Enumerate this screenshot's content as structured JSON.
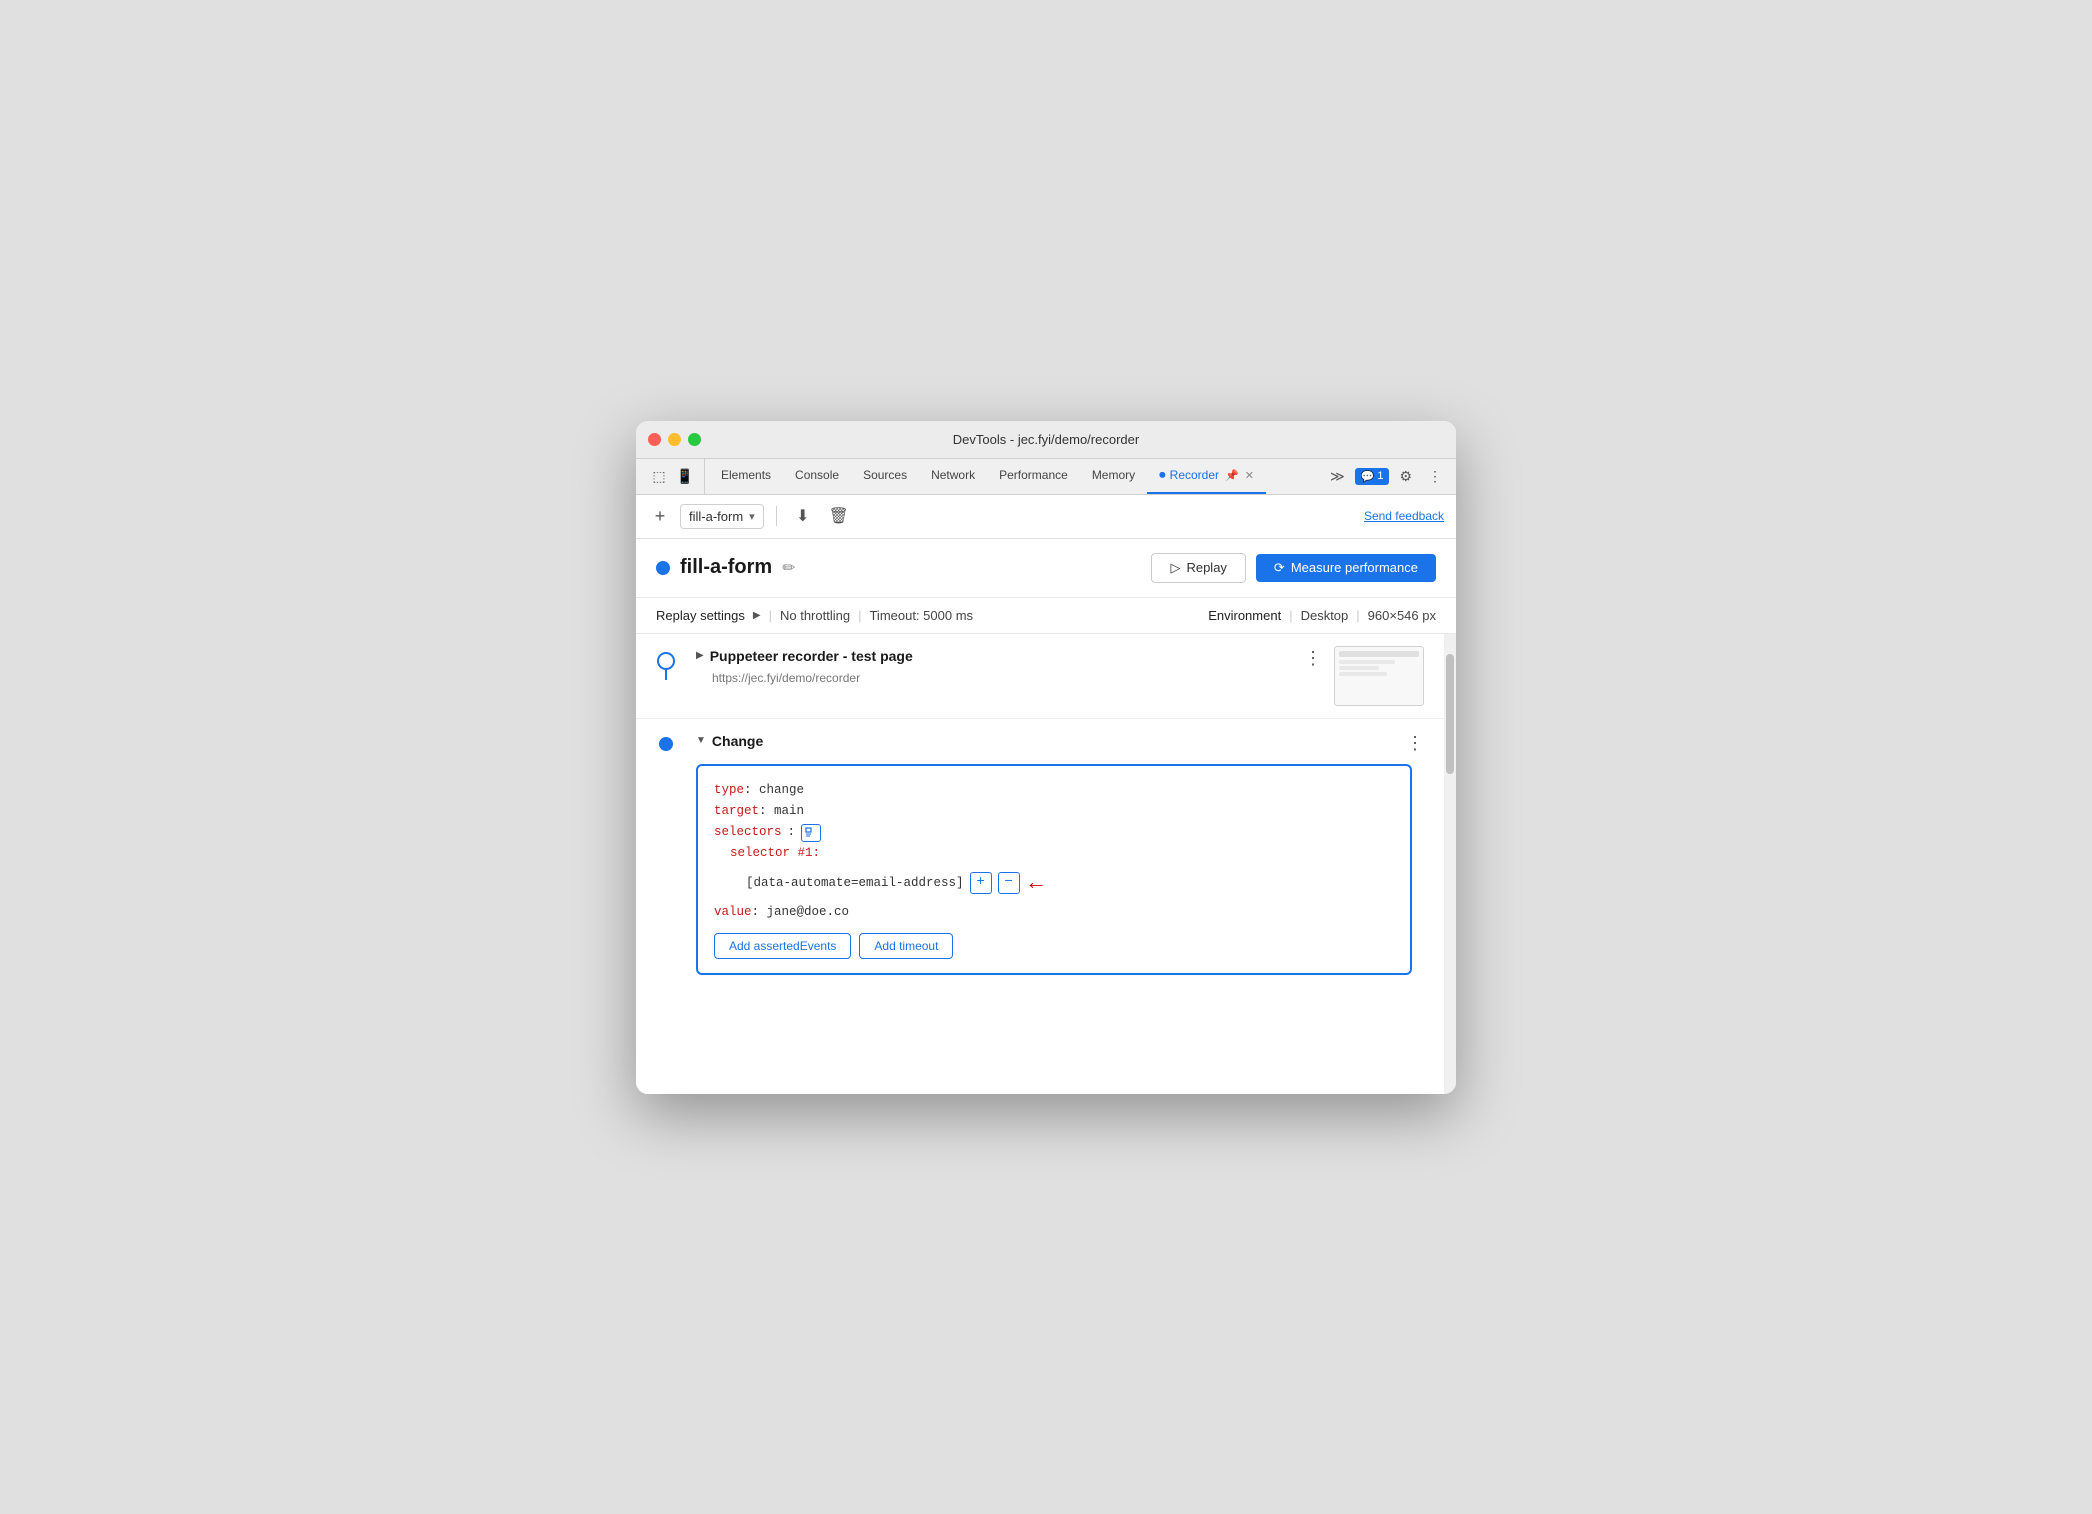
{
  "window": {
    "title": "DevTools - jec.fyi/demo/recorder"
  },
  "tabs": {
    "items": [
      {
        "label": "Elements",
        "active": false
      },
      {
        "label": "Console",
        "active": false
      },
      {
        "label": "Sources",
        "active": false
      },
      {
        "label": "Network",
        "active": false
      },
      {
        "label": "Performance",
        "active": false
      },
      {
        "label": "Memory",
        "active": false
      },
      {
        "label": "Recorder",
        "active": true
      }
    ],
    "recorder_icon": "🎬",
    "more_icon": "≫",
    "chat_count": "1",
    "settings_icon": "⚙",
    "kebab_icon": "⋮"
  },
  "toolbar": {
    "add_label": "+",
    "recording_name": "fill-a-form",
    "download_icon": "⬇",
    "delete_icon": "🗑",
    "send_feedback": "Send feedback"
  },
  "recording": {
    "title": "fill-a-form",
    "edit_icon": "✏",
    "replay_label": "Replay",
    "measure_label": "Measure performance",
    "replay_settings_label": "Replay settings",
    "no_throttling": "No throttling",
    "timeout": "Timeout: 5000 ms",
    "environment_label": "Environment",
    "desktop": "Desktop",
    "viewport": "960×546 px"
  },
  "steps": {
    "step1": {
      "title": "Puppeteer recorder - test page",
      "url": "https://jec.fyi/demo/recorder"
    },
    "step2": {
      "title": "Change",
      "code": {
        "type_key": "type",
        "type_val": "change",
        "target_key": "target",
        "target_val": "main",
        "selectors_key": "selectors",
        "selector_num": "selector #1:",
        "selector_value": "[data-automate=email-address]",
        "value_key": "value",
        "value_val": "jane@doe.co"
      },
      "add_asserted_events": "Add assertedEvents",
      "add_timeout": "Add timeout"
    }
  }
}
